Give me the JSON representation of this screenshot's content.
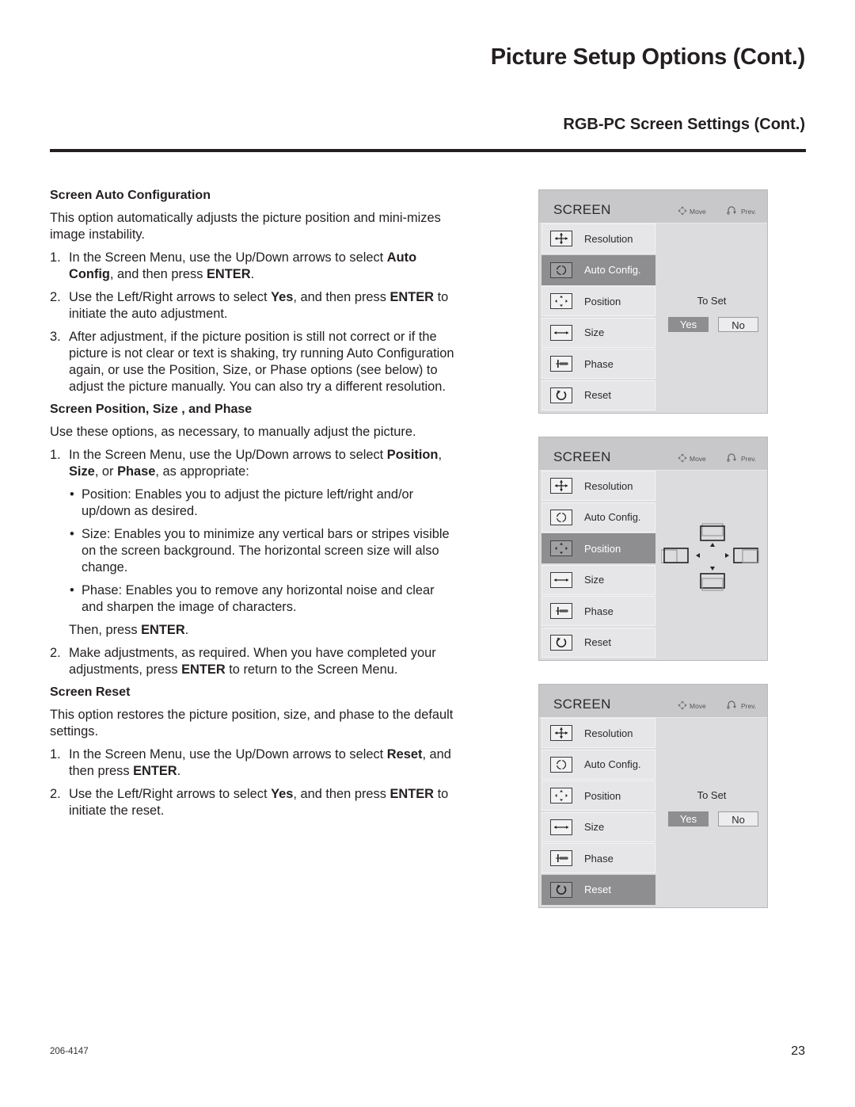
{
  "header": {
    "page_title": "Picture Setup Options (Cont.)",
    "section_title": "RGB-PC Screen Settings (Cont.)"
  },
  "auto_config": {
    "heading": "Screen Auto Configuration",
    "intro": "This option automatically adjusts the picture position and mini-mizes image instability.",
    "steps": [
      {
        "num": "1.",
        "parts": [
          "In the Screen Menu, use the Up/Down arrows to select ",
          "Auto Config",
          ", and then press ",
          "ENTER",
          "."
        ]
      },
      {
        "num": "2.",
        "parts": [
          "Use the Left/Right arrows to select ",
          "Yes",
          ", and then press ",
          "ENTER",
          " to initiate the auto adjustment."
        ]
      },
      {
        "num": "3.",
        "text": "After adjustment, if the picture position is still not correct or if the picture is not clear or text is shaking, try running Auto Configuration again, or use the Position, Size, or Phase options (see below) to adjust the picture manually. You can also try a different resolution."
      }
    ]
  },
  "position_size_phase": {
    "heading": "Screen Position, Size , and Phase",
    "intro": "Use these options, as necessary, to manually adjust the picture.",
    "step1": {
      "num": "1.",
      "parts": [
        "In the Screen Menu, use the Up/Down arrows to select ",
        "Position",
        ", ",
        "Size",
        ", or ",
        "Phase",
        ", as appropriate:"
      ]
    },
    "bullets": [
      "Position: Enables you to adjust the picture left/right and/or up/down as desired.",
      "Size: Enables you to minimize any vertical bars or stripes visible on the screen background. The horizontal screen size will also change.",
      "Phase: Enables you to remove any horizontal noise and clear and sharpen the image of characters."
    ],
    "then": [
      "Then, press ",
      "ENTER",
      "."
    ],
    "step2": {
      "num": "2.",
      "parts": [
        "Make adjustments, as required. When you have completed your adjustments, press ",
        "ENTER",
        " to return to the Screen Menu."
      ]
    }
  },
  "reset": {
    "heading": "Screen Reset",
    "intro": "This option restores the picture position, size, and phase to the default settings.",
    "steps": [
      {
        "num": "1.",
        "parts": [
          "In the Screen Menu, use the Up/Down arrows to select ",
          "Reset",
          ",  and then press ",
          "ENTER",
          "."
        ]
      },
      {
        "num": "2.",
        "parts": [
          "Use the Left/Right arrows to select ",
          "Yes",
          ", and then press ",
          "ENTER",
          " to initiate the reset."
        ]
      }
    ]
  },
  "osd": {
    "title": "SCREEN",
    "move_label": "Move",
    "prev_label": "Prev.",
    "items": [
      "Resolution",
      "Auto Config.",
      "Position",
      "Size",
      "Phase",
      "Reset"
    ],
    "to_set": "To Set",
    "yes": "Yes",
    "no": "No",
    "menus": [
      {
        "selected": "Auto Config.",
        "panel": "confirm"
      },
      {
        "selected": "Position",
        "panel": "position"
      },
      {
        "selected": "Reset",
        "panel": "confirm"
      }
    ]
  },
  "footer": {
    "doc_number": "206-4147",
    "page_number": "23"
  }
}
